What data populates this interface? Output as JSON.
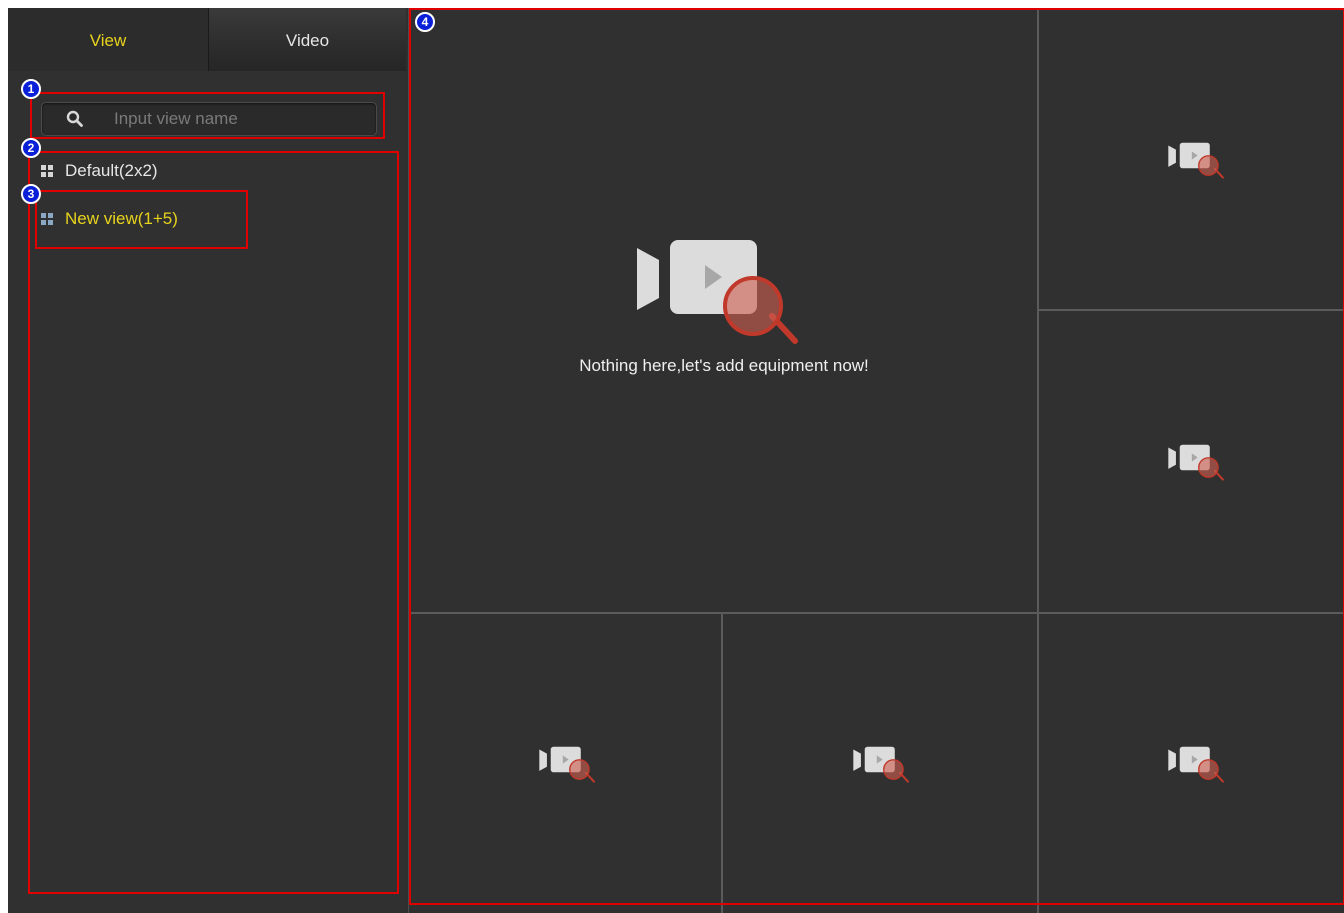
{
  "sidebar": {
    "tabs": [
      {
        "label": "View",
        "active": true
      },
      {
        "label": "Video",
        "active": false
      }
    ],
    "search": {
      "placeholder": "Input view name",
      "value": ""
    },
    "views": [
      {
        "label": "Default(2x2)",
        "selected": false
      },
      {
        "label": "New view(1+5)",
        "selected": true
      }
    ]
  },
  "main": {
    "layout": "1+5",
    "empty_message": "Nothing here,let's add equipment now!",
    "panes": [
      {
        "id": "main",
        "icon": "camera-search-icon"
      },
      {
        "id": "right-top",
        "icon": "camera-search-icon"
      },
      {
        "id": "right-mid",
        "icon": "camera-search-icon"
      },
      {
        "id": "bottom-left",
        "icon": "camera-search-icon"
      },
      {
        "id": "bottom-mid",
        "icon": "camera-search-icon"
      },
      {
        "id": "bottom-right",
        "icon": "camera-search-icon"
      }
    ]
  },
  "annotations": [
    {
      "number": "1"
    },
    {
      "number": "2"
    },
    {
      "number": "3"
    },
    {
      "number": "4"
    }
  ],
  "colors": {
    "active_tab_text": "#e8d31c",
    "selected_item_text": "#e8d31c",
    "annotation_border": "#e00000",
    "badge_fill": "#0a1fd8",
    "background": "#303030"
  }
}
